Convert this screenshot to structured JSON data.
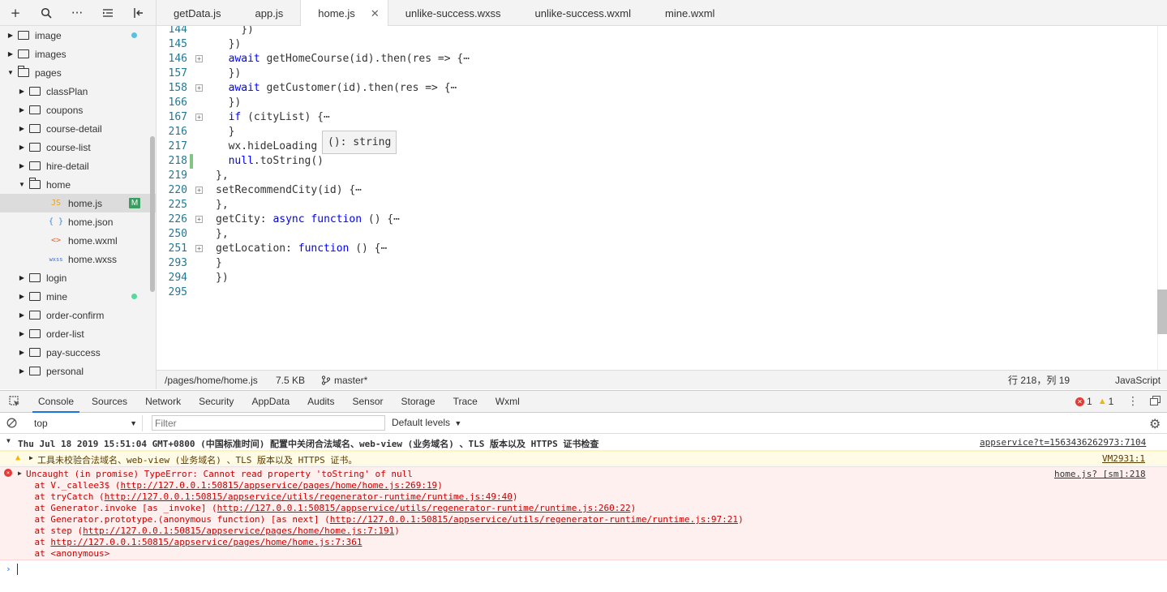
{
  "toolbar": {
    "icons": [
      "plus-icon",
      "search-icon",
      "more-icon",
      "collapse-icon",
      "sidebar-toggle-icon"
    ]
  },
  "tree": [
    {
      "label": "image",
      "type": "folder",
      "open": false,
      "indent": 0,
      "dot": "#5bc0de"
    },
    {
      "label": "images",
      "type": "folder",
      "open": false,
      "indent": 0
    },
    {
      "label": "pages",
      "type": "folder",
      "open": true,
      "indent": 0
    },
    {
      "label": "classPlan",
      "type": "folder",
      "open": false,
      "indent": 1
    },
    {
      "label": "coupons",
      "type": "folder",
      "open": false,
      "indent": 1
    },
    {
      "label": "course-detail",
      "type": "folder",
      "open": false,
      "indent": 1
    },
    {
      "label": "course-list",
      "type": "folder",
      "open": false,
      "indent": 1
    },
    {
      "label": "hire-detail",
      "type": "folder",
      "open": false,
      "indent": 1
    },
    {
      "label": "home",
      "type": "folder",
      "open": true,
      "indent": 1
    },
    {
      "label": "home.js",
      "type": "js",
      "indent": 2,
      "selected": true,
      "badge": "M"
    },
    {
      "label": "home.json",
      "type": "json",
      "indent": 2
    },
    {
      "label": "home.wxml",
      "type": "wxml",
      "indent": 2
    },
    {
      "label": "home.wxss",
      "type": "wxss",
      "indent": 2
    },
    {
      "label": "login",
      "type": "folder",
      "open": false,
      "indent": 1
    },
    {
      "label": "mine",
      "type": "folder",
      "open": false,
      "indent": 1,
      "dot": "#5cd6a0"
    },
    {
      "label": "order-confirm",
      "type": "folder",
      "open": false,
      "indent": 1
    },
    {
      "label": "order-list",
      "type": "folder",
      "open": false,
      "indent": 1
    },
    {
      "label": "pay-success",
      "type": "folder",
      "open": false,
      "indent": 1
    },
    {
      "label": "personal",
      "type": "folder",
      "open": false,
      "indent": 1
    }
  ],
  "tabs": [
    {
      "label": "getData.js"
    },
    {
      "label": "app.js"
    },
    {
      "label": "home.js",
      "active": true
    },
    {
      "label": "unlike-success.wxss"
    },
    {
      "label": "unlike-success.wxml"
    },
    {
      "label": "mine.wxml"
    }
  ],
  "code": [
    {
      "n": "144",
      "t": "    })"
    },
    {
      "n": "145",
      "t": "  })"
    },
    {
      "n": "146",
      "t": "  await getHomeCourse(id).then(res => {⋯",
      "fold": true
    },
    {
      "n": "157",
      "t": "  })"
    },
    {
      "n": "158",
      "t": "  await getCustomer(id).then(res => {⋯",
      "fold": true
    },
    {
      "n": "166",
      "t": "  })"
    },
    {
      "n": "167",
      "t": "  if (cityList) {⋯",
      "fold": true
    },
    {
      "n": "216",
      "t": "  }"
    },
    {
      "n": "217",
      "t": "  wx.hideLoading"
    },
    {
      "n": "218",
      "t": "  null.toString()",
      "mod": true
    },
    {
      "n": "219",
      "t": "},"
    },
    {
      "n": "220",
      "t": "setRecommendCity(id) {⋯",
      "fold": true
    },
    {
      "n": "225",
      "t": "},"
    },
    {
      "n": "226",
      "t": "getCity: async function () {⋯",
      "fold": true
    },
    {
      "n": "250",
      "t": "},"
    },
    {
      "n": "251",
      "t": "getLocation: function () {⋯",
      "fold": true
    },
    {
      "n": "293",
      "t": "}"
    },
    {
      "n": "294",
      "t": "})"
    },
    {
      "n": "295",
      "t": ""
    }
  ],
  "tooltip": "(): string",
  "status": {
    "path": "/pages/home/home.js",
    "size": "7.5 KB",
    "branch": "master*",
    "position": "行 218，列 19",
    "language": "JavaScript"
  },
  "devtools": {
    "tabs": [
      "Console",
      "Sources",
      "Network",
      "Security",
      "AppData",
      "Audits",
      "Sensor",
      "Storage",
      "Trace",
      "Wxml"
    ],
    "error_count": "1",
    "warning_count": "1",
    "context": "top",
    "filter_placeholder": "Filter",
    "levels": "Default levels"
  },
  "console": {
    "group_title": "Thu Jul 18 2019 15:51:04 GMT+0800 (中国标准时间) 配置中关闭合法域名、web-view (业务域名) 、TLS 版本以及 HTTPS 证书检查",
    "group_link": "appservice?t=1563436262973:7104",
    "warning": "工具未校验合法域名、web-view (业务域名) 、TLS 版本以及 HTTPS 证书。",
    "warning_link": "VM2931:1",
    "error": "Uncaught (in promise) TypeError: Cannot read property 'toString' of null",
    "error_link": "home.js? [sm]:218",
    "stack": [
      {
        "pre": "    at V._callee3$ (",
        "url": "http://127.0.0.1:50815/appservice/pages/home/home.js:269:19",
        "post": ")"
      },
      {
        "pre": "    at tryCatch (",
        "url": "http://127.0.0.1:50815/appservice/utils/regenerator-runtime/runtime.js:49:40",
        "post": ")"
      },
      {
        "pre": "    at Generator.invoke [as _invoke] (",
        "url": "http://127.0.0.1:50815/appservice/utils/regenerator-runtime/runtime.js:260:22",
        "post": ")"
      },
      {
        "pre": "    at Generator.prototype.(anonymous function) [as next] (",
        "url": "http://127.0.0.1:50815/appservice/utils/regenerator-runtime/runtime.js:97:21",
        "post": ")"
      },
      {
        "pre": "    at step (",
        "url": "http://127.0.0.1:50815/appservice/pages/home/home.js:7:191",
        "post": ")"
      },
      {
        "pre": "    at ",
        "url": "http://127.0.0.1:50815/appservice/pages/home/home.js:7:361",
        "post": ""
      },
      {
        "pre": "    at <anonymous>",
        "url": "",
        "post": ""
      }
    ]
  }
}
